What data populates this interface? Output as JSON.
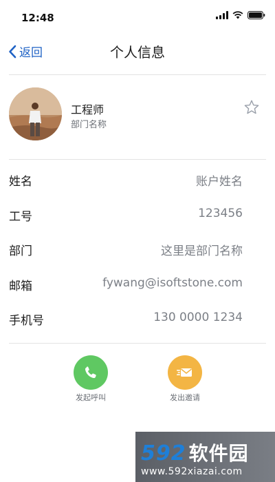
{
  "status_bar": {
    "time": "12:48"
  },
  "nav": {
    "back_label": "返回",
    "title": "个人信息"
  },
  "profile": {
    "name": "工程师",
    "department": "部门名称"
  },
  "info": [
    {
      "label": "姓名",
      "value": "账户姓名"
    },
    {
      "label": "工号",
      "value": "123456"
    },
    {
      "label": "部门",
      "value": "这里是部门名称"
    },
    {
      "label": "邮箱",
      "value": "fywang@isoftstone.com"
    },
    {
      "label": "手机号",
      "value": "130 0000 1234"
    }
  ],
  "actions": {
    "call_label": "发起呼叫",
    "invite_label": "发出邀请",
    "call_color": "#5fc862",
    "invite_color": "#f3b544"
  },
  "colors": {
    "accent": "#1f62c5"
  },
  "watermark": {
    "logo": "592",
    "brand": "软件园",
    "url": "www.592xiazai.com"
  }
}
